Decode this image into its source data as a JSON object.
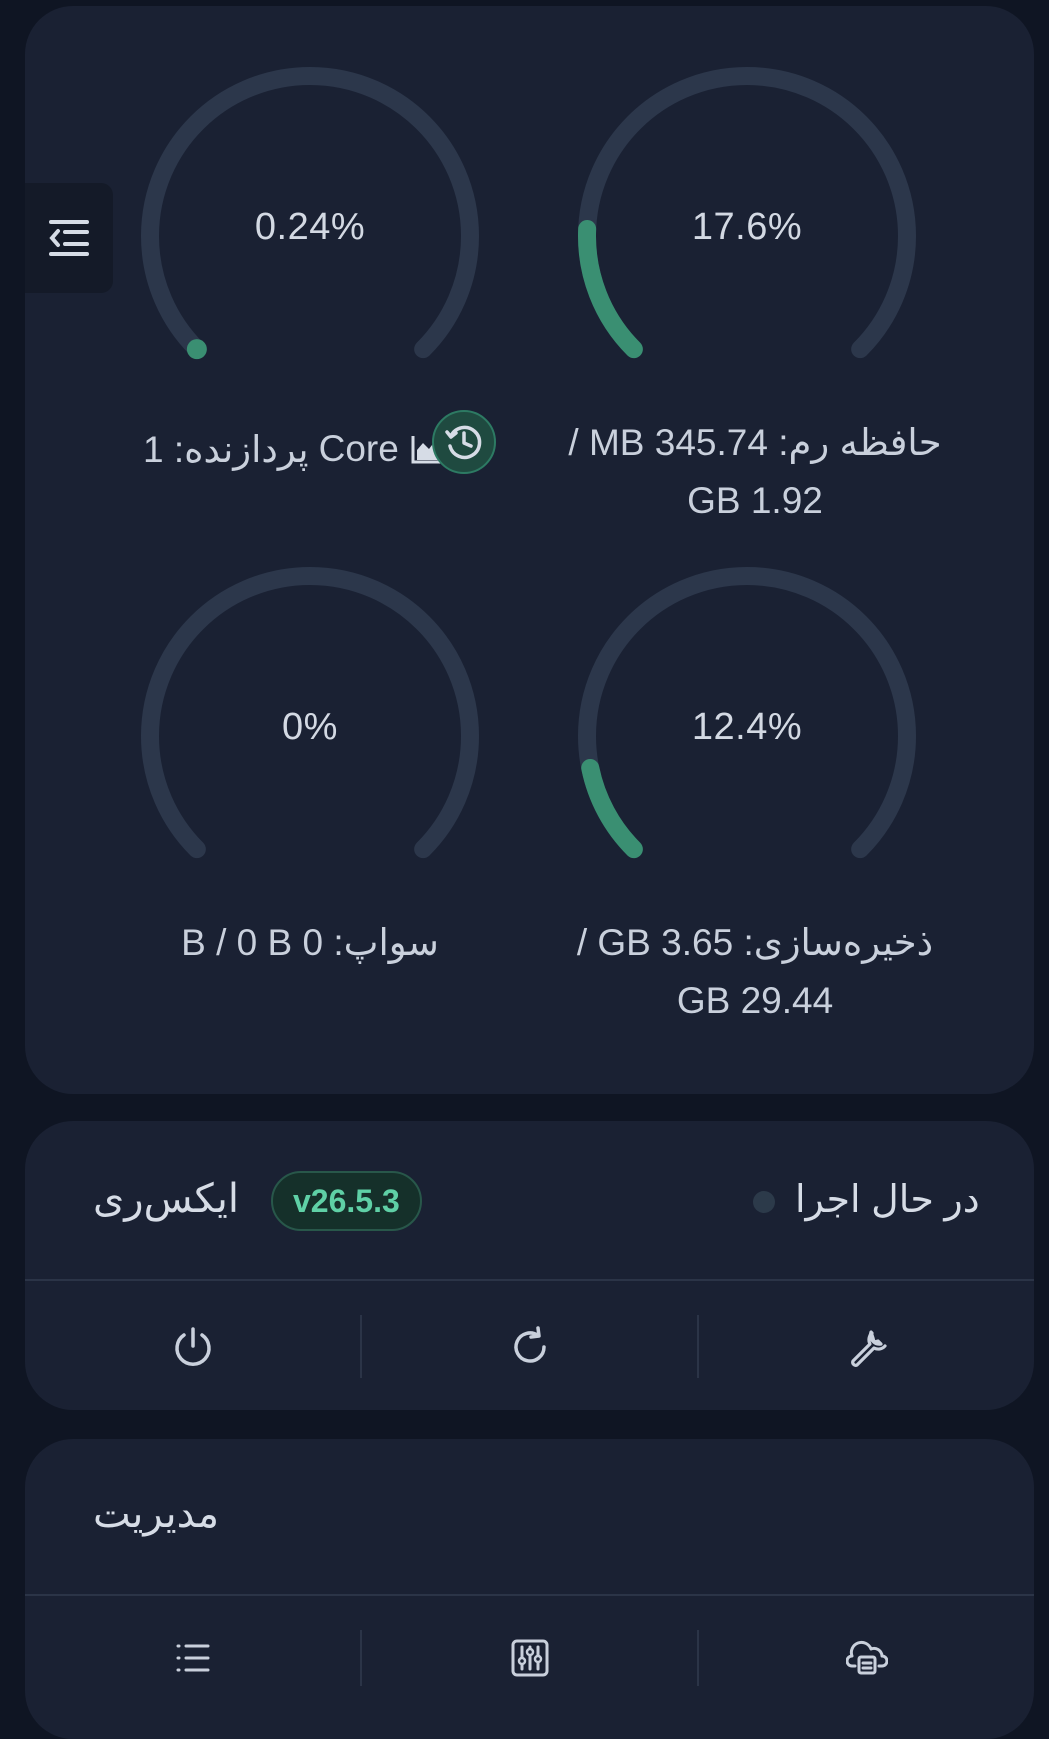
{
  "stats": {
    "cpu": {
      "percent_text": "0.24%",
      "percent": 0.24,
      "label_prefix": "پردازنده: 1",
      "core_text": "Core"
    },
    "ram": {
      "percent_text": "17.6%",
      "percent": 17.6,
      "label_line1": "حافظه رم: 345.74 MB /",
      "label_line2": "1.92 GB"
    },
    "swap": {
      "percent_text": "0%",
      "percent": 0,
      "label_line1": "سواپ: 0 B / 0 B"
    },
    "storage": {
      "percent_text": "12.4%",
      "percent": 12.4,
      "label_line1": "ذخیره‌سازی: 3.65 GB /",
      "label_line2": "29.44 GB"
    }
  },
  "xray": {
    "title": "ایکس‌ری",
    "version": "v26.5.3",
    "status": "در حال اجرا",
    "actions": [
      "power-icon",
      "restart-icon",
      "wrench-icon"
    ]
  },
  "management": {
    "title": "مدیریت",
    "actions": [
      "list-icon",
      "sliders-icon",
      "backup-icon"
    ]
  },
  "colors": {
    "accent": "#3a8f72",
    "track": "#2c374b",
    "card": "#1a2133",
    "background": "#0f1523"
  }
}
